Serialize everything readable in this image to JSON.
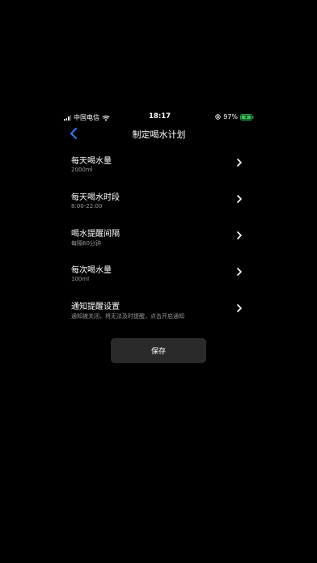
{
  "status_bar": {
    "carrier": "中国电信",
    "time": "18:17",
    "battery": "97%",
    "battery_level": 0.97,
    "icons": [
      "signal-icon",
      "wifi-icon",
      "orientation-lock-icon",
      "battery-charging-icon"
    ]
  },
  "nav": {
    "title": "制定喝水计划",
    "back_icon": "chevron-left-icon"
  },
  "items": [
    {
      "title": "每天喝水量",
      "subtitle": "2000ml"
    },
    {
      "title": "每天喝水时段",
      "subtitle": "8:00-22:00"
    },
    {
      "title": "喝水提醒间隔",
      "subtitle": "每隔60分钟"
    },
    {
      "title": "每次喝水量",
      "subtitle": "100ml"
    },
    {
      "title": "通知提醒设置",
      "subtitle": "通知被关闭，将无法及时提醒，点击开启通知"
    }
  ],
  "save_label": "保存",
  "colors": {
    "background": "#000000",
    "accent": "#2f7cf6",
    "battery_green": "#34c759",
    "button_bg": "#2a2a2a"
  }
}
